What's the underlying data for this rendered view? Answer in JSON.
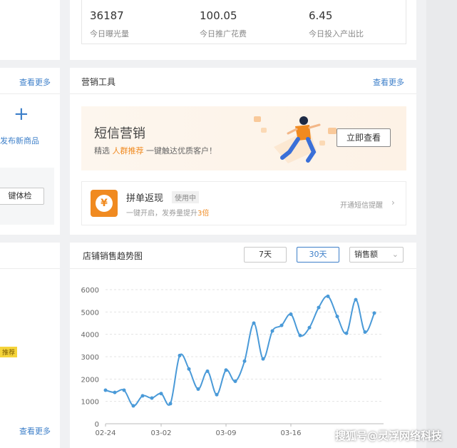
{
  "stats": [
    {
      "value": "36187",
      "label": "今日曝光量"
    },
    {
      "value": "100.05",
      "label": "今日推广花费"
    },
    {
      "value": "6.45",
      "label": "今日投入产出比"
    }
  ],
  "left": {
    "more_top": "查看更多",
    "publish_label": "发布新商品",
    "check_button": "键体检",
    "tag": "推荐",
    "more_bottom": "查看更多"
  },
  "marketing": {
    "title": "营销工具",
    "more": "查看更多",
    "sms": {
      "title": "短信营销",
      "sub_prefix": "精选",
      "sub_highlight": "人群推荐",
      "sub_suffix": "一键触达优质客户！",
      "button": "立即查看"
    },
    "group": {
      "title": "拼单返现",
      "badge": "使用中",
      "desc_prefix": "一键开启，发券量提升",
      "desc_highlight": "3倍",
      "action": "开通短信提醒"
    }
  },
  "trend": {
    "title": "店铺销售趋势图",
    "range_buttons": [
      "7天",
      "30天"
    ],
    "active_range": "30天",
    "metric_select": "销售额"
  },
  "watermark": "搜狐号@灵浮网络科技",
  "colors": {
    "accent": "#3d7fc9",
    "line": "#4a9ad8",
    "orange": "#f08a20"
  },
  "chart_data": {
    "type": "line",
    "x": [
      "02-24",
      "02-25",
      "02-26",
      "02-27",
      "02-28",
      "03-01",
      "03-02",
      "03-03",
      "03-04",
      "03-05",
      "03-06",
      "03-07",
      "03-08",
      "03-09",
      "03-10",
      "03-11",
      "03-12",
      "03-13",
      "03-14",
      "03-15",
      "03-16",
      "03-17",
      "03-18",
      "03-19",
      "03-20",
      "03-21",
      "03-22",
      "03-23",
      "03-24",
      "03-25",
      "03-26"
    ],
    "x_ticks": [
      "02-24",
      "03-02",
      "03-09",
      "03-16"
    ],
    "y_ticks": [
      0,
      1000,
      2000,
      3000,
      4000,
      5000,
      6000
    ],
    "ylim": [
      0,
      6000
    ],
    "series": [
      {
        "values": [
          1500,
          1400,
          1500,
          800,
          1250,
          1150,
          1350,
          900,
          3050,
          2450,
          1550,
          2350,
          1300,
          2400,
          1900,
          2800,
          4500,
          2900,
          4150,
          4400,
          4900,
          3950,
          4300,
          5200,
          5700,
          4800,
          4050,
          5550,
          4100,
          4950
        ]
      }
    ]
  }
}
